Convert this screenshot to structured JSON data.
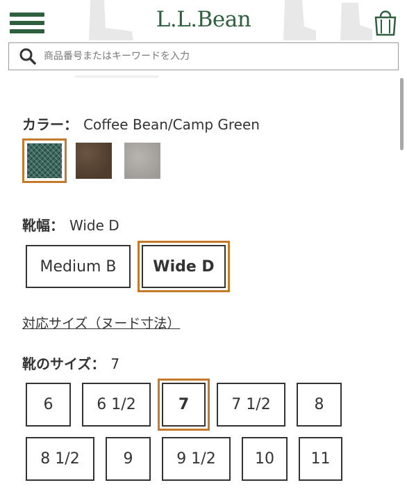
{
  "header": {
    "logo": "L.L.Bean",
    "search_placeholder": "商品番号またはキーワードを入力"
  },
  "color": {
    "label": "カラー：",
    "selected": "Coffee Bean/Camp Green",
    "swatches": [
      {
        "name": "Coffee Bean/Camp Green",
        "color": "#3f6a60"
      },
      {
        "name": "Brown",
        "color": "#5a4533"
      },
      {
        "name": "Gray",
        "color": "#a9a6a2"
      }
    ]
  },
  "width": {
    "label": "靴幅：",
    "selected": "Wide D",
    "options": [
      "Medium B",
      "Wide D"
    ]
  },
  "size_chart_link": "対応サイズ（ヌード寸法）",
  "size": {
    "label": "靴のサイズ：",
    "selected": "7",
    "options_row1": [
      "6",
      "6 1/2",
      "7",
      "7 1/2",
      "8"
    ],
    "options_row2": [
      "8 1/2",
      "9",
      "9 1/2",
      "10",
      "11"
    ]
  },
  "colors": {
    "brand_green": "#2f5f3f",
    "selected_outline": "#c47a2a"
  }
}
